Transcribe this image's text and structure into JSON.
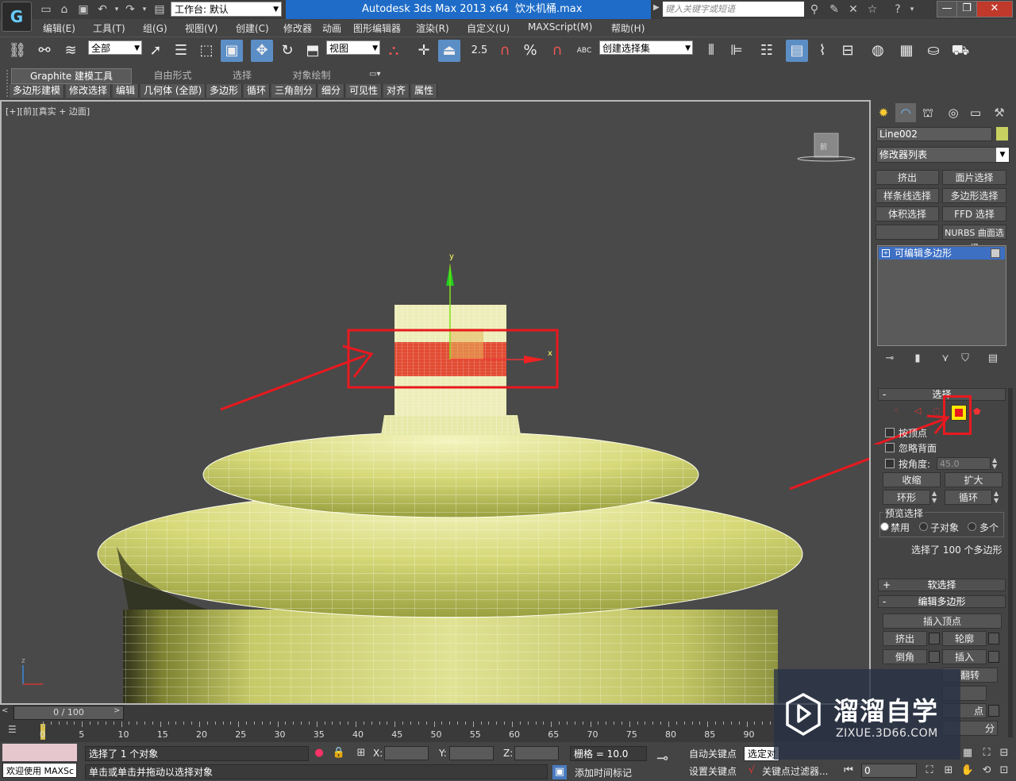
{
  "titlebar": {
    "workspace_value": "工作台: 默认",
    "app_title": "Autodesk 3ds Max  2013 x64",
    "file_name": "饮水机桶.max",
    "search_placeholder": "键入关键字或短语",
    "help_glyph": "?",
    "window_buttons": [
      "—",
      "❐",
      "✕"
    ]
  },
  "menu": [
    "编辑(E)",
    "工具(T)",
    "组(G)",
    "视图(V)",
    "创建(C)",
    "修改器",
    "动画",
    "图形编辑器",
    "渲染(R)",
    "自定义(U)",
    "MAXScript(M)",
    "帮助(H)"
  ],
  "toolbar": {
    "filter_value": "全部",
    "coord_value": "视图",
    "snap_percent": "%",
    "snap_25": "2.5",
    "named_selection": "创建选择集",
    "abc_label": "ABC"
  },
  "ribbon": {
    "tabs": [
      "Graphite 建模工具",
      "自由形式",
      "选择",
      "对象绘制"
    ],
    "buttons": [
      "多边形建模",
      "修改选择",
      "编辑",
      "几何体 (全部)",
      "多边形",
      "循环",
      "三角剖分",
      "细分",
      "可见性",
      "对齐",
      "属性"
    ]
  },
  "viewport": {
    "label": "[+][前][真实 + 边面]",
    "axis_y": "y",
    "axis_x": "x",
    "mini_axis_z": "z",
    "viewcube_label": "前"
  },
  "command_panel": {
    "object_name": "Line002",
    "object_color": "#c8d060",
    "modifier_list": "修改器列表",
    "modifier_buttons": [
      "挤出",
      "面片选择",
      "样条线选择",
      "多边形选择",
      "体积选择",
      "FFD 选择",
      "",
      "NURBS 曲面选择"
    ],
    "stack_item": "可编辑多边形",
    "selection_rollout": {
      "title": "选择",
      "by_vertex": "按顶点",
      "ignore_backfacing": "忽略背面",
      "by_angle": "按角度:",
      "angle_value": "45.0",
      "shrink": "收缩",
      "grow": "扩大",
      "ring": "环形",
      "loop": "循环",
      "preview_title": "预览选择",
      "preview_options": [
        "禁用",
        "子对象",
        "多个"
      ],
      "status": "选择了 100 个多边形"
    },
    "soft_selection": "软选择",
    "edit_polygons": {
      "title": "编辑多边形",
      "insert_vertex": "插入顶点",
      "extrude": "挤出",
      "outline": "轮廓",
      "bevel": "倒角",
      "inset": "插入",
      "flip": "翻转",
      "hidden_suffix": "点",
      "hidden_suffix2": "分"
    }
  },
  "timeline": {
    "frame_display": "0 / 100",
    "ticks": [
      "0",
      "5",
      "10",
      "15",
      "20",
      "25",
      "30",
      "35",
      "40",
      "45",
      "50",
      "55",
      "60",
      "65",
      "70",
      "75",
      "80",
      "85",
      "90"
    ]
  },
  "statusbar": {
    "maxscript_label": "欢迎使用 MAXSc",
    "selection_status": "选择了 1 个对象",
    "prompt": "单击或单击并拖动以选择对象",
    "x_label": "X:",
    "y_label": "Y:",
    "z_label": "Z:",
    "grid": "栅格 = 10.0",
    "add_time_tag": "添加时间标记",
    "auto_key": "自动关键点",
    "set_key": "设置关键点",
    "selected_dropdown": "选定对",
    "key_filters": "关键点过滤器...",
    "frame_value": "0"
  },
  "watermark": {
    "title": "溜溜自学",
    "url": "ZIXUE.3D66.COM"
  },
  "colors": {
    "title_blue": "#1e6cc8",
    "selection_red": "#e8191f",
    "mesh_yellow": "#d8da7a"
  }
}
